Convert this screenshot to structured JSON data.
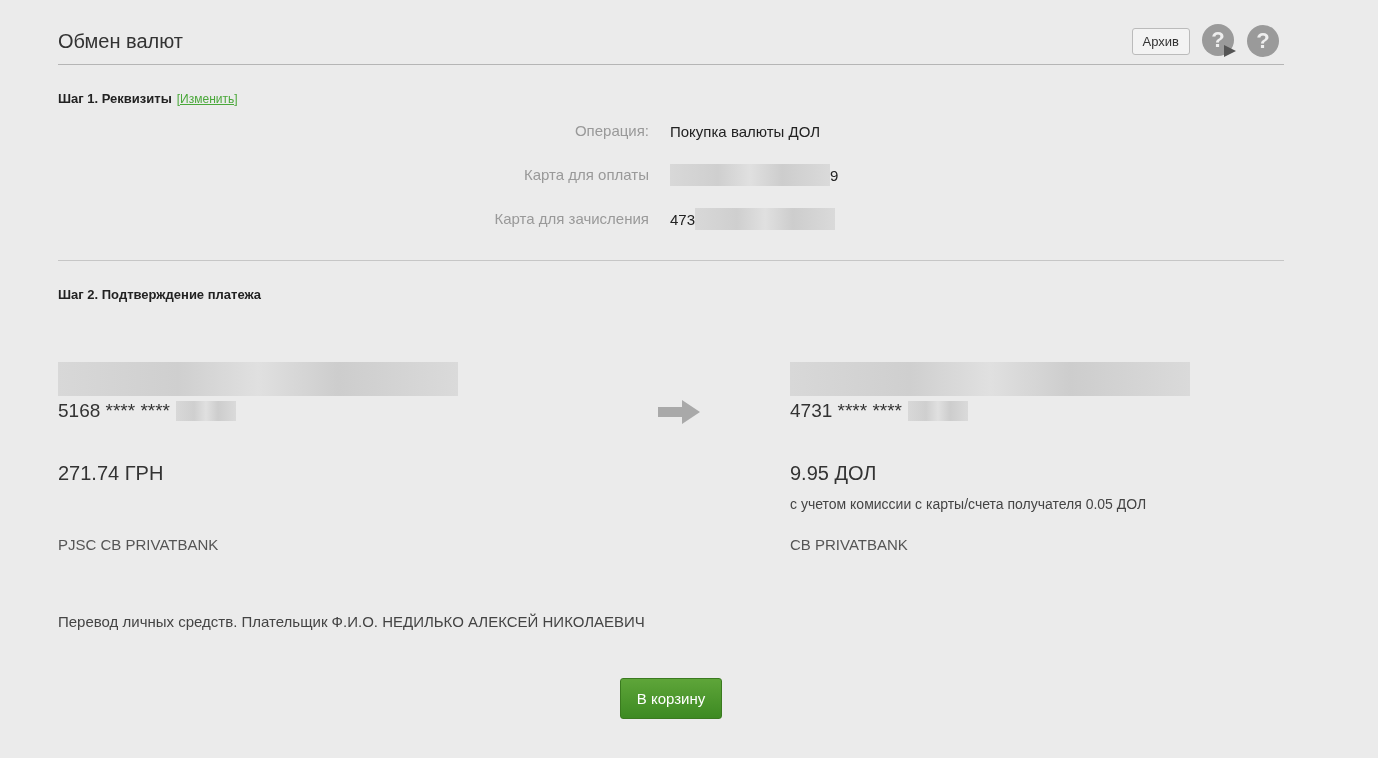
{
  "header": {
    "title": "Обмен валют",
    "archive_button": "Архив",
    "help_icons": [
      {
        "kind": "video",
        "glyph": "?"
      },
      {
        "kind": "plain",
        "glyph": "?"
      }
    ]
  },
  "step1": {
    "title": "Шаг 1. Реквизиты",
    "edit_link": "[Изменить]",
    "rows": [
      {
        "label": "Операция:",
        "value": "Покупка валюты ДОЛ",
        "kind": "plain"
      },
      {
        "label": "Карта для оплаты",
        "value": "9",
        "kind": "masked_start"
      },
      {
        "label": "Карта для зачисления",
        "value": "473",
        "kind": "masked_end"
      }
    ]
  },
  "step2": {
    "title": "Шаг 2. Подтверждение платежа",
    "from": {
      "card_number": "5168 **** ****",
      "amount": "271.74 ГРН",
      "bank": "PJSC CB PRIVATBANK"
    },
    "to": {
      "card_number": "4731 **** ****",
      "amount": "9.95 ДОЛ",
      "note": "с учетом комиссии с карты/счета получателя 0.05 ДОЛ",
      "bank": "CB PRIVATBANK"
    },
    "purpose": "Перевод личных средств. Плательщик Ф.И.О. НЕДИЛЬКО АЛЕКСЕЙ НИКОЛАЕВИЧ",
    "submit_button": "В корзину"
  }
}
